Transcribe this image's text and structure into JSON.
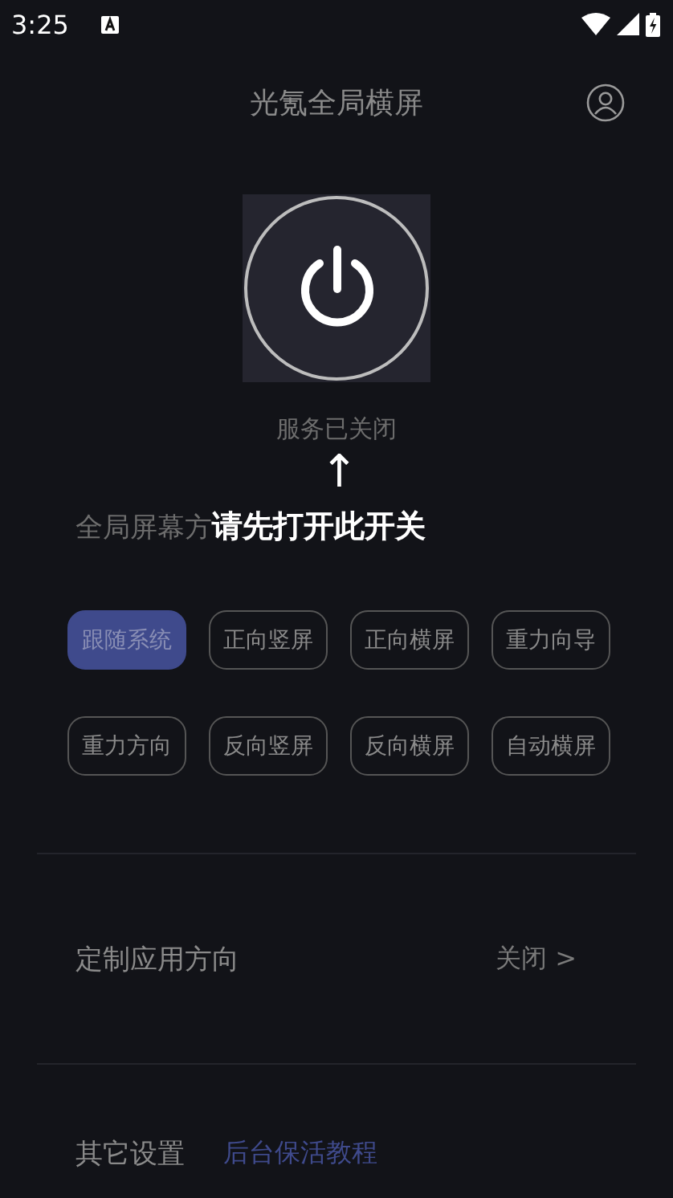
{
  "status_bar": {
    "time": "3:25"
  },
  "header": {
    "title": "光氪全局横屏"
  },
  "service": {
    "on": false,
    "status": "服务已关闭",
    "hint_arrow": "↑",
    "hint": "请先打开此开关"
  },
  "orientation": {
    "label": "全局屏幕方",
    "options": [
      {
        "label": "跟随系统",
        "selected": true
      },
      {
        "label": "正向竖屏",
        "selected": false
      },
      {
        "label": "正向横屏",
        "selected": false
      },
      {
        "label": "重力向导",
        "selected": false
      },
      {
        "label": "重力方向",
        "selected": false
      },
      {
        "label": "反向竖屏",
        "selected": false
      },
      {
        "label": "反向横屏",
        "selected": false
      },
      {
        "label": "自动横屏",
        "selected": false
      }
    ]
  },
  "custom_app": {
    "label": "定制应用方向",
    "value": "关闭 >"
  },
  "other": {
    "label": "其它设置",
    "link": "后台保活教程"
  }
}
